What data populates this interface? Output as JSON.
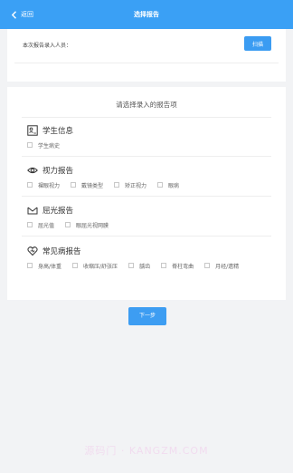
{
  "navbar": {
    "back_label": "返回",
    "title": "选择报告"
  },
  "top": {
    "staff_label": "本次报告录入人员：",
    "scan_label": "扫描"
  },
  "main": {
    "title": "请选择录入的报告项",
    "sections": [
      {
        "title": "学生信息",
        "icon": "student-card-icon",
        "options": [
          "学生病史"
        ]
      },
      {
        "title": "视力报告",
        "icon": "eye-icon",
        "options": [
          "裸眼视力",
          "戴镜类型",
          "矫正视力",
          "眼病"
        ]
      },
      {
        "title": "屈光报告",
        "icon": "envelope-icon",
        "options": [
          "屈光值",
          "眼屈光视网膜"
        ]
      },
      {
        "title": "常见病报告",
        "icon": "heart-icon",
        "options": [
          "身高/体重",
          "收缩压/舒张压",
          "龋齿",
          "脊柱弯曲",
          "月经/遗精"
        ]
      }
    ]
  },
  "next_label": "下一步",
  "watermark": "源码门 · KANGZM.COM",
  "colors": {
    "primary": "#3aa0f5",
    "background": "#f2f3f5"
  }
}
